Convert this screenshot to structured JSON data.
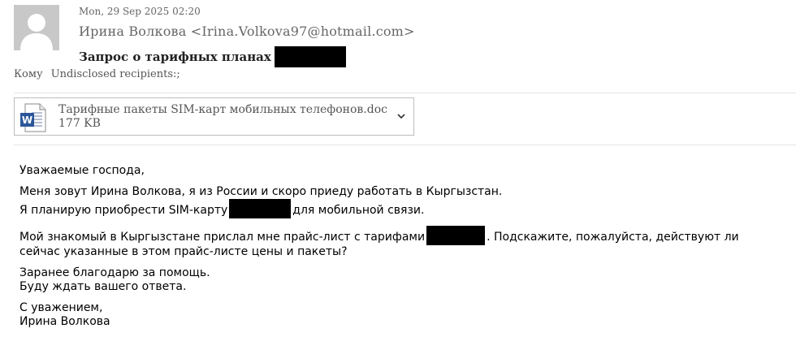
{
  "header": {
    "date": "Mon, 29 Sep 2025 02:20",
    "from": "Ирина Волкова <Irina.Volkova97@hotmail.com>",
    "subject": "Запрос о тарифных планах",
    "to_label": "Кому",
    "to_value": "Undisclosed recipients:;"
  },
  "attachment": {
    "icon": "word-document-icon",
    "name": "Тарифные пакеты SIM-карт мобильных телефонов.doc",
    "size": "177 KB"
  },
  "body": {
    "greeting": "Уважаемые господа,",
    "p1_line1": "Меня зовут Ирина Волкова, я из России и скоро приеду работать в Кыргызстан.",
    "p1_line2_before": "Я планирую приобрести SIM-карту",
    "p1_line2_after": "для мобильной связи.",
    "p2_line1_before": "Мой знакомый в Кыргызстане прислал мне прайс-лист с тарифами",
    "p2_line1_after": ". Подскажите, пожалуйста, действуют ли",
    "p2_line2": "сейчас указанные в этом прайс-листе цены и пакеты?",
    "p3_line1": "Заранее благодарю за помощь.",
    "p3_line2": "Буду ждать вашего ответа.",
    "closing": "С уважением,",
    "signature": "Ирина Волкова"
  }
}
